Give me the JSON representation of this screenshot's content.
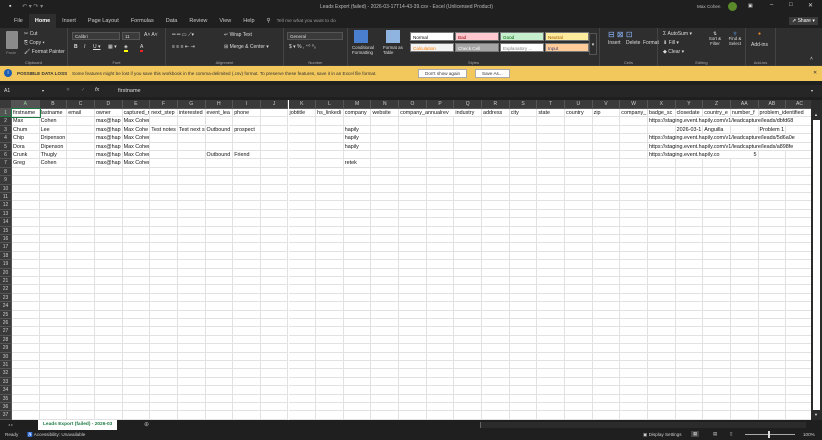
{
  "app": {
    "title": "Leads Export (failed) - 2026-03-17T14-43-39.csv - Excel (Unlicensed Product)",
    "user": "Max Cohen",
    "share": "Share"
  },
  "menu_tabs": [
    "File",
    "Home",
    "Insert",
    "Page Layout",
    "Formulas",
    "Data",
    "Review",
    "View",
    "Help"
  ],
  "tell_me": "Tell me what you want to do",
  "ribbon": {
    "clipboard": {
      "paste": "Paste",
      "cut": "Cut",
      "copy": "Copy",
      "format_painter": "Format Painter",
      "label": "Clipboard"
    },
    "font": {
      "name": "Calibri",
      "size": "11",
      "label": "Font"
    },
    "alignment": {
      "wrap": "Wrap Text",
      "merge": "Merge & Center",
      "label": "Alignment"
    },
    "number": {
      "format": "General",
      "label": "Number"
    },
    "styles": {
      "conditional": "Conditional Formatting",
      "format_table": "Format as Table",
      "label": "Styles",
      "cells": [
        {
          "name": "Normal",
          "bg": "#ffffff",
          "fg": "#000000"
        },
        {
          "name": "Bad",
          "bg": "#ffc7ce",
          "fg": "#9c0006"
        },
        {
          "name": "Good",
          "bg": "#c6efce",
          "fg": "#006100"
        },
        {
          "name": "Neutral",
          "bg": "#ffeb9c",
          "fg": "#9c5700"
        },
        {
          "name": "Calculation",
          "bg": "#f2f2f2",
          "fg": "#fa7d00"
        },
        {
          "name": "Check Cell",
          "bg": "#a5a5a5",
          "fg": "#ffffff"
        },
        {
          "name": "Explanatory ...",
          "bg": "#ffffff",
          "fg": "#7f7f7f"
        },
        {
          "name": "Input",
          "bg": "#ffcc99",
          "fg": "#3f3f76"
        }
      ]
    },
    "cells": {
      "insert": "Insert",
      "delete": "Delete",
      "format": "Format",
      "label": "Cells"
    },
    "editing": {
      "autosum": "AutoSum",
      "fill": "Fill",
      "clear": "Clear",
      "sort": "Sort & Filter",
      "find": "Find & Select",
      "label": "Editing"
    },
    "addins": {
      "addins": "Add-ins",
      "label": "Add-ins"
    }
  },
  "message": {
    "title": "POSSIBLE DATA LOSS",
    "text": "Some features might be lost if you save this workbook in the comma-delimited (.csv) format. To preserve these features, save it in an Excel file format.",
    "dont_show": "Don't show again",
    "save_as": "Save As..."
  },
  "formula": {
    "name_box": "A1",
    "fx": "fx",
    "value": "firstname"
  },
  "columns": [
    "A",
    "B",
    "C",
    "D",
    "E",
    "F",
    "G",
    "H",
    "I",
    "J",
    "K",
    "L",
    "M",
    "N",
    "O",
    "P",
    "Q",
    "R",
    "S",
    "T",
    "U",
    "V",
    "W",
    "X",
    "Y",
    "Z",
    "AA",
    "AB",
    "AC"
  ],
  "row_count": 37,
  "rows": [
    [
      "firstname",
      "lastname",
      "email",
      "owner",
      "captured_notes",
      "next_step",
      "interested",
      "event_lea",
      "phone",
      "",
      "jobtitle",
      "hs_linkedi",
      "company",
      "website",
      "company_annualrev",
      "",
      "industry",
      "address",
      "city",
      "state",
      "country",
      "zip",
      "company_",
      "badge_sc",
      "closedate",
      "country_e",
      "number_f",
      "problem_identified",
      ""
    ],
    [
      "Max",
      "Cohen",
      "",
      "max@hap",
      "Max Cohen",
      "",
      "",
      "",
      "",
      "",
      "",
      "",
      "",
      "",
      "",
      "",
      "",
      "",
      "",
      "",
      "",
      "",
      "",
      "https://staging.event.hapily.com/v1/leadcapture/leads/dbfd68",
      "",
      "",
      "",
      "",
      ""
    ],
    [
      "Chum",
      "Lee",
      "",
      "max@hap",
      "Max Cohe",
      "Test notes",
      "Test next s",
      "Outbound",
      "prospect",
      "",
      "",
      "",
      "hapily",
      "",
      "",
      "",
      "",
      "",
      "",
      "",
      "",
      "",
      "",
      "",
      "2026-03-1",
      "Anguilla",
      "",
      "Problem 1",
      ""
    ],
    [
      "Chip",
      "Dripenson",
      "",
      "max@hap",
      "Max Cohen",
      "",
      "",
      "",
      "",
      "",
      "",
      "",
      "hapily",
      "",
      "",
      "",
      "",
      "",
      "",
      "",
      "",
      "",
      "",
      "https://staging.event.hapily.com/v1/leadcapture/leads/5d6a0e",
      "",
      "",
      "",
      "",
      ""
    ],
    [
      "Dora",
      "Dipenson",
      "",
      "max@hap",
      "Max Cohen",
      "",
      "",
      "",
      "",
      "",
      "",
      "",
      "hapily",
      "",
      "",
      "",
      "",
      "",
      "",
      "",
      "",
      "",
      "",
      "https://staging.event.hapily.com/v1/leadcapture/leads/a898fe",
      "",
      "",
      "",
      "",
      ""
    ],
    [
      "Crunk",
      "Thugly",
      "",
      "max@hap",
      "Max Cohen",
      "",
      "",
      "Outbound",
      "Friend",
      "",
      "",
      "",
      "",
      "",
      "",
      "",
      "",
      "",
      "",
      "",
      "",
      "",
      "",
      "https://staging.event.hapily.co",
      "",
      "",
      "5",
      "",
      ""
    ],
    [
      "Greg",
      "Cohen",
      "",
      "max@hap",
      "Max Cohen",
      "",
      "",
      "",
      "",
      "",
      "",
      "",
      "retek",
      "",
      "",
      "",
      "",
      "",
      "",
      "",
      "",
      "",
      "",
      "",
      "",
      "",
      "",
      "",
      ""
    ]
  ],
  "right_aligned": [
    "2026-03-1",
    "5"
  ],
  "sheet_tab": "Leads Export (failed) - 2026-03",
  "status": {
    "ready": "Ready",
    "accessibility": "Accessibility: Unavailable",
    "display": "Display Settings",
    "zoom": "100%"
  },
  "zoom_level": 100
}
